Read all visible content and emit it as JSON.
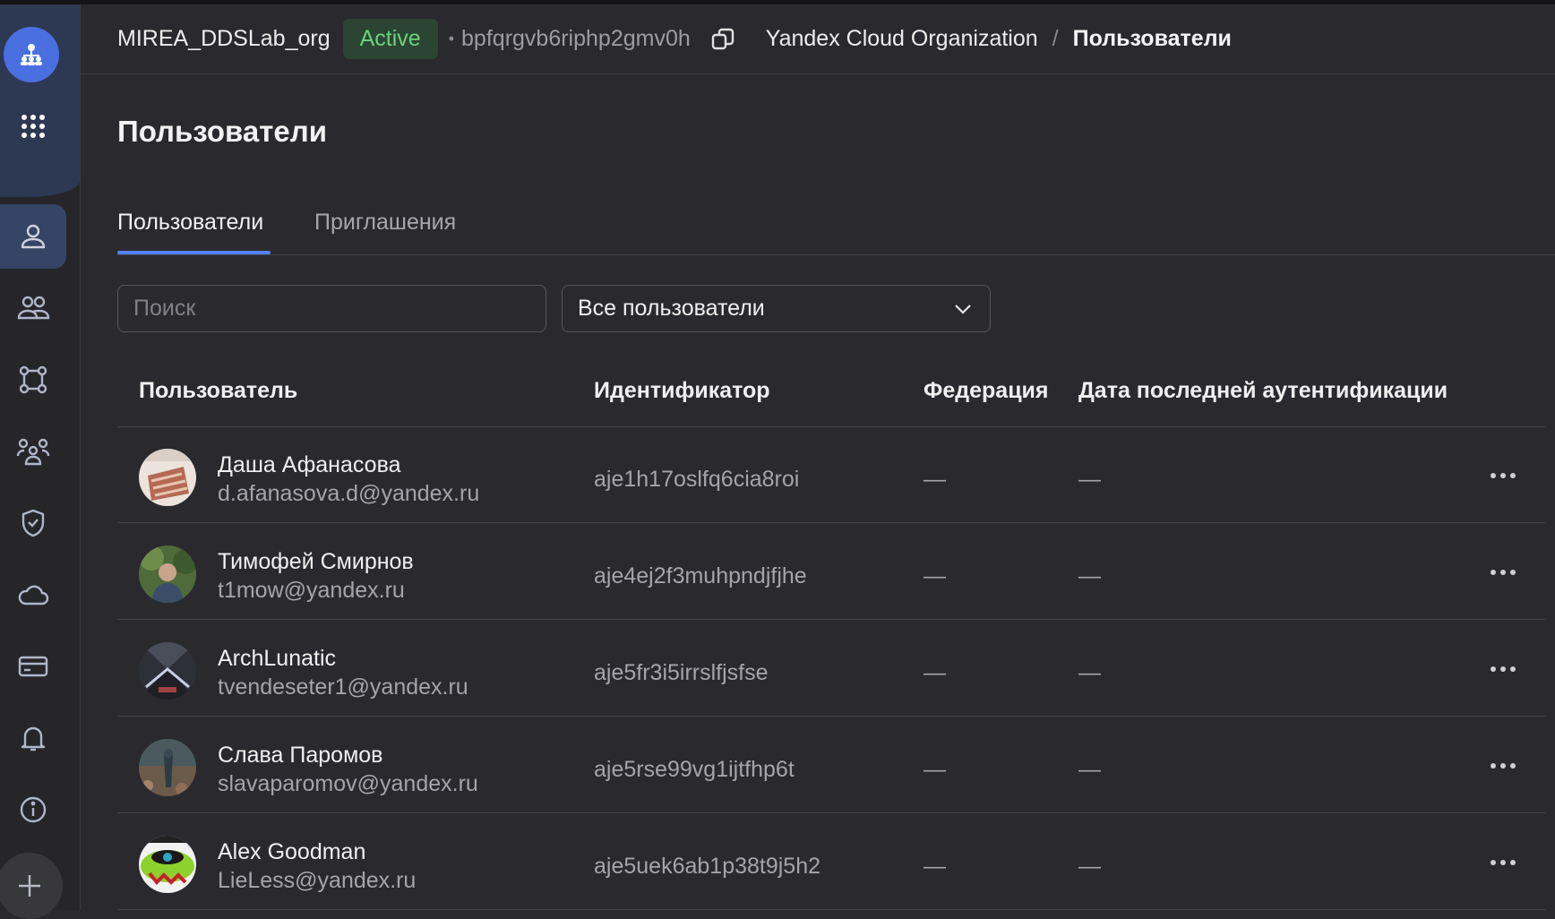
{
  "sidebar": {
    "logo_icon": "organization-icon",
    "items": [
      {
        "icon": "apps-grid-icon"
      },
      {
        "icon": "user-icon",
        "active": true
      },
      {
        "icon": "users-group-icon"
      },
      {
        "icon": "federation-icon"
      },
      {
        "icon": "groups-icon"
      },
      {
        "icon": "shield-icon"
      },
      {
        "icon": "cloud-icon"
      },
      {
        "icon": "billing-card-icon"
      },
      {
        "icon": "bell-icon"
      },
      {
        "icon": "info-icon"
      },
      {
        "icon": "plus-icon"
      }
    ]
  },
  "header": {
    "org_name": "MIREA_DDSLab_org",
    "status": "Active",
    "dot": "•",
    "org_id": "bpfqrgvb6riphp2gmv0h",
    "breadcrumb": {
      "root": "Yandex Cloud Organization",
      "separator": "/",
      "current": "Пользователи"
    }
  },
  "page": {
    "title": "Пользователи",
    "tabs": [
      {
        "label": "Пользователи",
        "active": true
      },
      {
        "label": "Приглашения",
        "active": false
      }
    ],
    "search": {
      "placeholder": "Поиск",
      "value": ""
    },
    "filter": {
      "selected": "Все пользователи"
    }
  },
  "table": {
    "columns": {
      "user": "Пользователь",
      "id": "Идентификатор",
      "federation": "Федерация",
      "last_auth": "Дата последней аутентификации"
    },
    "rows": [
      {
        "name": "Даша Афанасова",
        "email": "d.afanasova.d@yandex.ru",
        "id": "aje1h17oslfq6cia8roi",
        "federation": "—",
        "last_auth": "—"
      },
      {
        "name": "Тимофей Смирнов",
        "email": "t1mow@yandex.ru",
        "id": "aje4ej2f3muhpndjfjhe",
        "federation": "—",
        "last_auth": "—"
      },
      {
        "name": "ArchLunatic",
        "email": "tvendeseter1@yandex.ru",
        "id": "aje5fr3i5irrslfjsfse",
        "federation": "—",
        "last_auth": "—"
      },
      {
        "name": "Слава Паромов",
        "email": "slavaparomov@yandex.ru",
        "id": "aje5rse99vg1ijtfhp6t",
        "federation": "—",
        "last_auth": "—"
      },
      {
        "name": "Alex Goodman",
        "email": "LieLess@yandex.ru",
        "id": "aje5uek6ab1p38t9j5h2",
        "federation": "—",
        "last_auth": "—"
      }
    ]
  },
  "colors": {
    "background": "#2a2a2e",
    "sidebar_accent": "#2d3853",
    "logo": "#4a6fe0",
    "active_badge_bg": "#2c4532",
    "active_badge_text": "#6bd17f",
    "tab_underline": "#5282ff"
  }
}
